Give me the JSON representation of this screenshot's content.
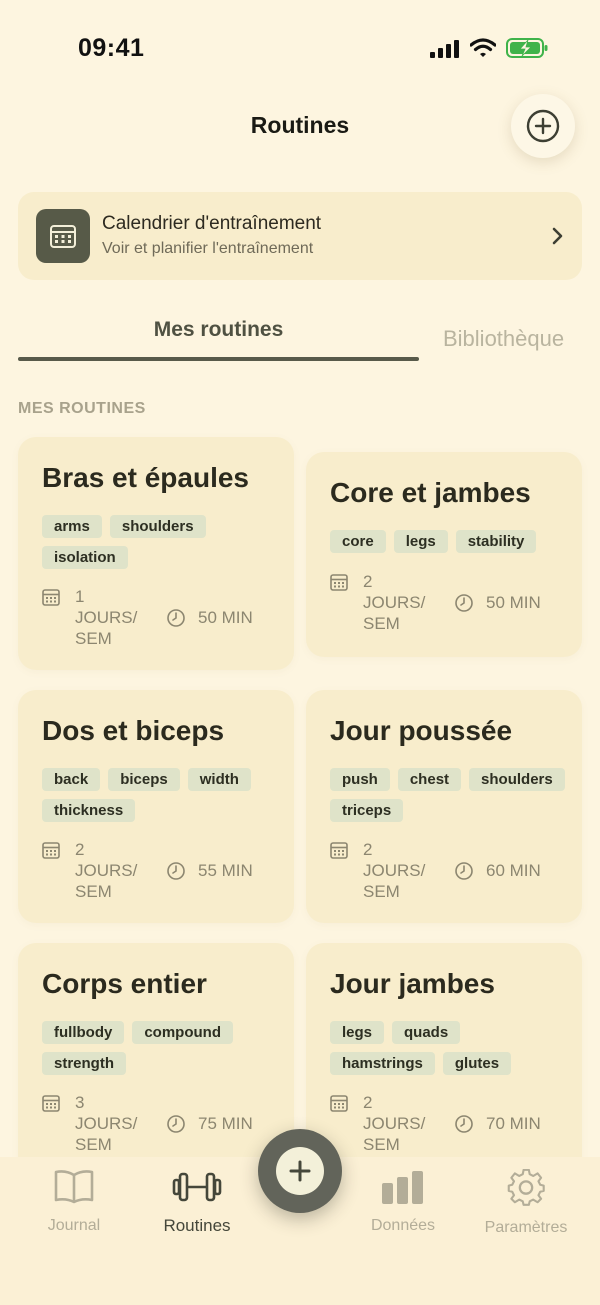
{
  "status_bar": {
    "time": "09:41"
  },
  "header": {
    "title": "Routines"
  },
  "calendar_card": {
    "title": "Calendrier d'entraînement",
    "subtitle": "Voir et planifier l'entraînement"
  },
  "tabs": [
    {
      "label": "Mes routines",
      "active": true
    },
    {
      "label": "Bibliothèque",
      "active": false
    }
  ],
  "section_label": "MES ROUTINES",
  "routines": [
    {
      "name": "Bras et épaules",
      "tags": [
        "arms",
        "shoulders",
        "isolation"
      ],
      "days": "1",
      "days_unit": "JOURS/",
      "days_unit2": "SEM",
      "duration": "50 MIN"
    },
    {
      "name": "Core et jambes",
      "tags": [
        "core",
        "legs",
        "stability"
      ],
      "days": "2",
      "days_unit": "JOURS/",
      "days_unit2": "SEM",
      "duration": "50 MIN"
    },
    {
      "name": "Dos et biceps",
      "tags": [
        "back",
        "biceps",
        "width",
        "thickness"
      ],
      "days": "2",
      "days_unit": "JOURS/",
      "days_unit2": "SEM",
      "duration": "55 MIN"
    },
    {
      "name": "Jour poussée",
      "tags": [
        "push",
        "chest",
        "shoulders",
        "triceps"
      ],
      "days": "2",
      "days_unit": "JOURS/",
      "days_unit2": "SEM",
      "duration": "60 MIN"
    },
    {
      "name": "Corps entier",
      "tags": [
        "fullbody",
        "compound",
        "strength"
      ],
      "days": "3",
      "days_unit": "JOURS/",
      "days_unit2": "SEM",
      "duration": "75 MIN"
    },
    {
      "name": "Jour jambes",
      "tags": [
        "legs",
        "quads",
        "hamstrings",
        "glutes"
      ],
      "days": "2",
      "days_unit": "JOURS/",
      "days_unit2": "SEM",
      "duration": "70 MIN"
    }
  ],
  "bottom_nav": {
    "items": [
      {
        "label": "Journal",
        "icon": "book-icon",
        "active": false
      },
      {
        "label": "Routines",
        "icon": "dumbbell-icon",
        "active": true
      },
      {
        "label": "Données",
        "icon": "bar-chart-icon",
        "active": false
      },
      {
        "label": "Paramètres",
        "icon": "gear-icon",
        "active": false
      }
    ]
  },
  "colors": {
    "background": "#fdf5e0",
    "card": "#f8edcc",
    "accent": "#585a4a",
    "tag": "#dfe3c9"
  }
}
